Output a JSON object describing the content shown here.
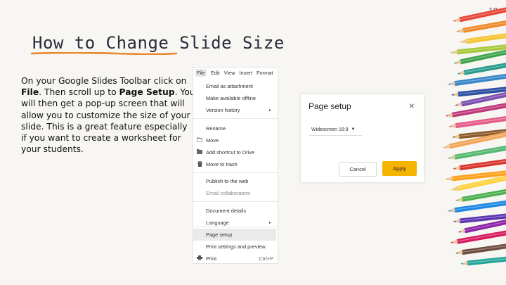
{
  "slide": {
    "page_number": "10",
    "title": "How to Change Slide Size",
    "body_parts": [
      "On your Google Slides Toolbar click on ",
      "File",
      ".  Then scroll up to ",
      "Page Setup",
      ".  You will then get a pop-up screen that will allow you to customize the size of your slide.  This is a great feature especially if you want to create a worksheet for your students."
    ]
  },
  "menu": {
    "menubar": [
      "File",
      "Edit",
      "View",
      "Insert",
      "Format"
    ],
    "items": [
      {
        "label": "Email as attachment",
        "icon": "",
        "shortcut": "",
        "submenu": false
      },
      {
        "label": "Make available offline",
        "icon": "",
        "shortcut": "",
        "submenu": false
      },
      {
        "label": "Version history",
        "icon": "",
        "shortcut": "",
        "submenu": true
      },
      {
        "label": "Rename",
        "icon": "",
        "shortcut": "",
        "submenu": false
      },
      {
        "label": "Move",
        "icon": "folder-icon",
        "shortcut": "",
        "submenu": false
      },
      {
        "label": "Add shortcut to Drive",
        "icon": "drive-shortcut-icon",
        "shortcut": "",
        "submenu": false
      },
      {
        "label": "Move to trash",
        "icon": "trash-icon",
        "shortcut": "",
        "submenu": false
      },
      {
        "label": "Publish to the web",
        "icon": "",
        "shortcut": "",
        "submenu": false
      },
      {
        "label": "Email collaborators",
        "icon": "",
        "shortcut": "",
        "submenu": false
      },
      {
        "label": "Document details",
        "icon": "",
        "shortcut": "",
        "submenu": false
      },
      {
        "label": "Language",
        "icon": "",
        "shortcut": "",
        "submenu": true
      },
      {
        "label": "Page setup",
        "icon": "",
        "shortcut": "",
        "submenu": false
      },
      {
        "label": "Print settings and preview",
        "icon": "",
        "shortcut": "",
        "submenu": false
      },
      {
        "label": "Print",
        "icon": "printer-icon",
        "shortcut": "Ctrl+P",
        "submenu": false
      }
    ]
  },
  "dialog": {
    "title": "Page setup",
    "select_value": "Widescreen 16:9",
    "cancel_label": "Cancel",
    "apply_label": "Apply"
  },
  "colors": {
    "accent_underline": "#e8872c",
    "apply_button": "#f4b400"
  }
}
